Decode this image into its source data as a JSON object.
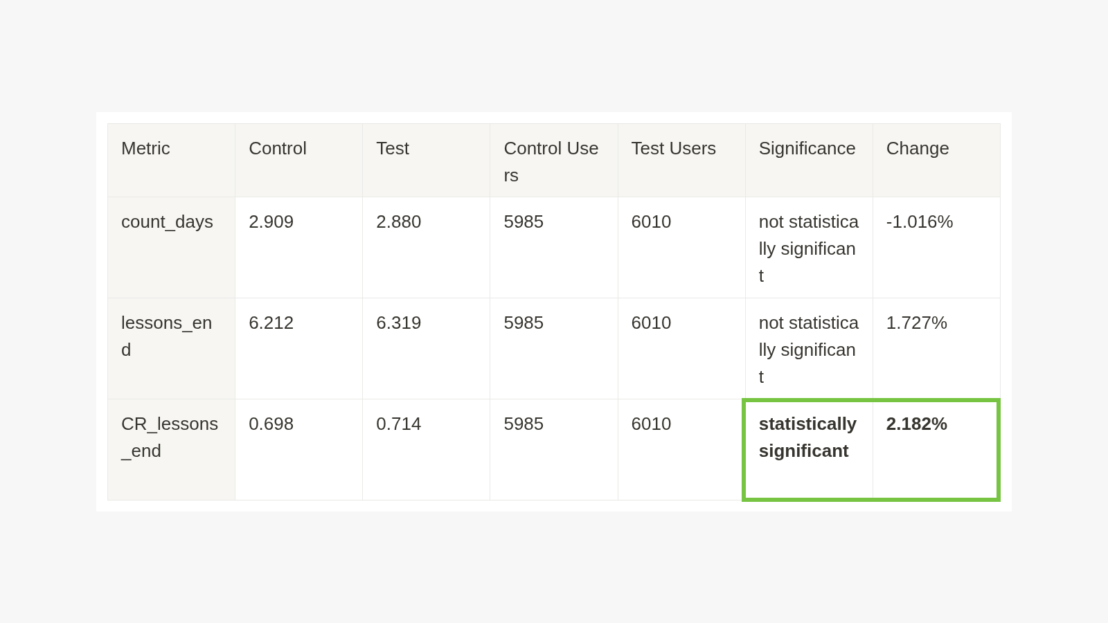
{
  "table": {
    "columns": [
      "Metric",
      "Control",
      "Test",
      "Control Users",
      "Test Users",
      "Significance",
      "Change"
    ],
    "rows": [
      {
        "cells": [
          {
            "text": "count_days",
            "highlighted": false
          },
          {
            "text": "2.909",
            "highlighted": false
          },
          {
            "text": "2.880",
            "highlighted": false
          },
          {
            "text": "5985",
            "highlighted": false
          },
          {
            "text": "6010",
            "highlighted": false
          },
          {
            "text": "not statistically significant",
            "highlighted": false
          },
          {
            "text": "-1.016%",
            "highlighted": false
          }
        ]
      },
      {
        "cells": [
          {
            "text": "lessons_end",
            "highlighted": false
          },
          {
            "text": "6.212",
            "highlighted": false
          },
          {
            "text": "6.319",
            "highlighted": false
          },
          {
            "text": "5985",
            "highlighted": false
          },
          {
            "text": "6010",
            "highlighted": false
          },
          {
            "text": "not statistically significant",
            "highlighted": false
          },
          {
            "text": "1.727%",
            "highlighted": false
          }
        ]
      },
      {
        "cells": [
          {
            "text": "CR_lessons_end",
            "highlighted": false
          },
          {
            "text": "0.698",
            "highlighted": false
          },
          {
            "text": "0.714",
            "highlighted": false
          },
          {
            "text": "5985",
            "highlighted": false
          },
          {
            "text": "6010",
            "highlighted": false
          },
          {
            "text": "statistically significant",
            "highlighted": true
          },
          {
            "text": "2.182%",
            "highlighted": true
          }
        ]
      }
    ]
  }
}
